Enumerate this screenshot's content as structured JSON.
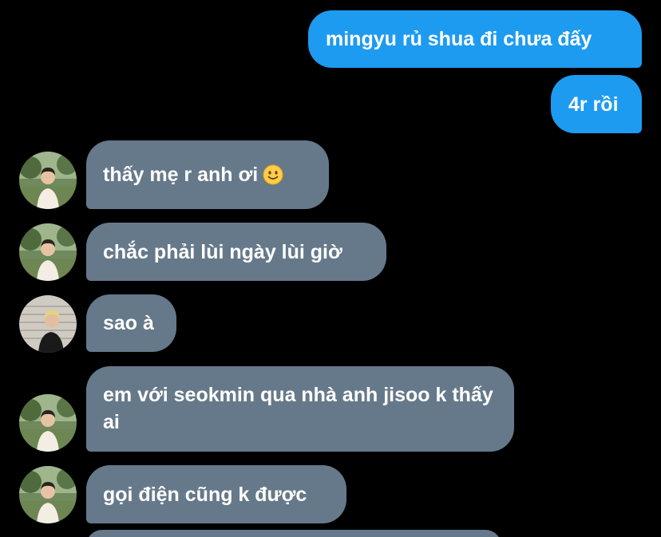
{
  "conversation": {
    "messages": [
      {
        "direction": "outgoing",
        "text": "mingyu rủ shua đi chưa đấy"
      },
      {
        "direction": "outgoing",
        "text": "4r rồi"
      },
      {
        "direction": "incoming",
        "text": "thấy mẹ r anh ơi",
        "emoji": "slightly-smiling-face-icon",
        "avatar": "user-avatar-a"
      },
      {
        "direction": "incoming",
        "text": "chắc phải lùi ngày lùi giờ",
        "avatar": "user-avatar-a"
      },
      {
        "direction": "incoming",
        "text": "sao à",
        "avatar": "user-avatar-b"
      },
      {
        "direction": "incoming",
        "text": "em với seokmin qua nhà anh jisoo k thấy ai",
        "avatar": "user-avatar-a"
      },
      {
        "direction": "incoming",
        "text": "gọi điện cũng k được",
        "avatar": "user-avatar-a"
      }
    ]
  },
  "colors": {
    "background": "#000000",
    "outgoing_bubble": "#1d9bf0",
    "incoming_bubble": "#66798a",
    "text": "#ffffff"
  }
}
